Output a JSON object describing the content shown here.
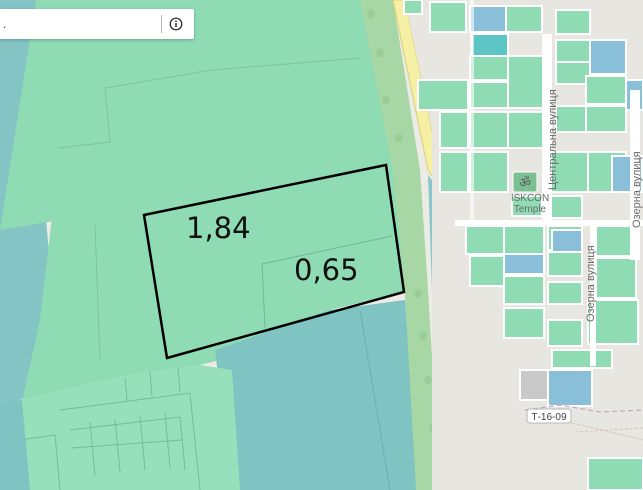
{
  "search": {
    "value": ".",
    "placeholder": ""
  },
  "labels": {
    "area_large": "1,84",
    "area_small": "0,65",
    "street_central": "Центральна вулиця",
    "street_ozerna_1": "Озерна вулиця",
    "street_ozerna_2": "Озерна вулиця",
    "poi_name_1": "ISKCON",
    "poi_name_2": "Temple",
    "road_code": "Т-16-09"
  },
  "colors": {
    "parcel_green": "#8fdcb4",
    "parcel_teal": "#7ec8c0",
    "water_blue": "#83b9cf",
    "road_yellow": "#f5f0a4",
    "outline": "#000000"
  },
  "icons": {
    "info": "info-icon",
    "tree": "tree-icon",
    "temple": "om-icon"
  }
}
